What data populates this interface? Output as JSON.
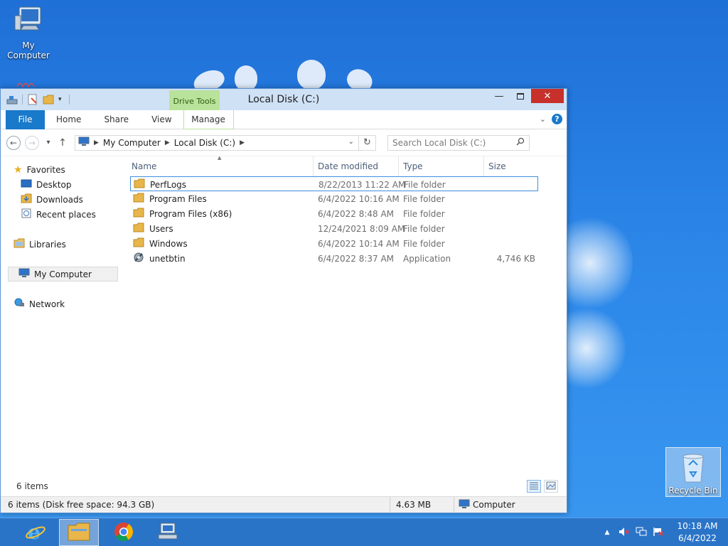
{
  "desktop": {
    "icons": {
      "my_computer": "My Computer",
      "recycle_bin": "Recycle Bin"
    }
  },
  "window": {
    "title": "Local Disk (C:)",
    "context_tab": "Drive Tools",
    "ribbon_tabs": [
      "File",
      "Home",
      "Share",
      "View",
      "Manage"
    ],
    "breadcrumb": [
      "My Computer",
      "Local Disk (C:)"
    ],
    "search_placeholder": "Search Local Disk (C:)",
    "nav": {
      "favorites": "Favorites",
      "desktop": "Desktop",
      "downloads": "Downloads",
      "recent": "Recent places",
      "libraries": "Libraries",
      "my_computer": "My Computer",
      "network": "Network"
    },
    "columns": {
      "name": "Name",
      "date": "Date modified",
      "type": "Type",
      "size": "Size"
    },
    "files": [
      {
        "name": "PerfLogs",
        "date": "8/22/2013 11:22 AM",
        "type": "File folder",
        "size": "",
        "icon": "folder-icon"
      },
      {
        "name": "Program Files",
        "date": "6/4/2022 10:16 AM",
        "type": "File folder",
        "size": "",
        "icon": "folder-icon"
      },
      {
        "name": "Program Files (x86)",
        "date": "6/4/2022 8:48 AM",
        "type": "File folder",
        "size": "",
        "icon": "folder-icon"
      },
      {
        "name": "Users",
        "date": "12/24/2021 8:09 AM",
        "type": "File folder",
        "size": "",
        "icon": "folder-icon"
      },
      {
        "name": "Windows",
        "date": "6/4/2022 10:14 AM",
        "type": "File folder",
        "size": "",
        "icon": "folder-icon"
      },
      {
        "name": "unetbtin",
        "date": "6/4/2022 8:37 AM",
        "type": "Application",
        "size": "4,746 KB",
        "icon": "application-icon"
      }
    ],
    "item_count": "6 items",
    "status": {
      "summary": "6 items (Disk free space: 94.3 GB)",
      "size": "4.63 MB",
      "location": "Computer"
    }
  },
  "taskbar": {
    "time": "10:18 AM",
    "date": "6/4/2022"
  },
  "colors": {
    "accent": "#1979ca",
    "close": "#c7302b",
    "context_tab": "#b9e39a",
    "folder": "#e8b64a"
  }
}
